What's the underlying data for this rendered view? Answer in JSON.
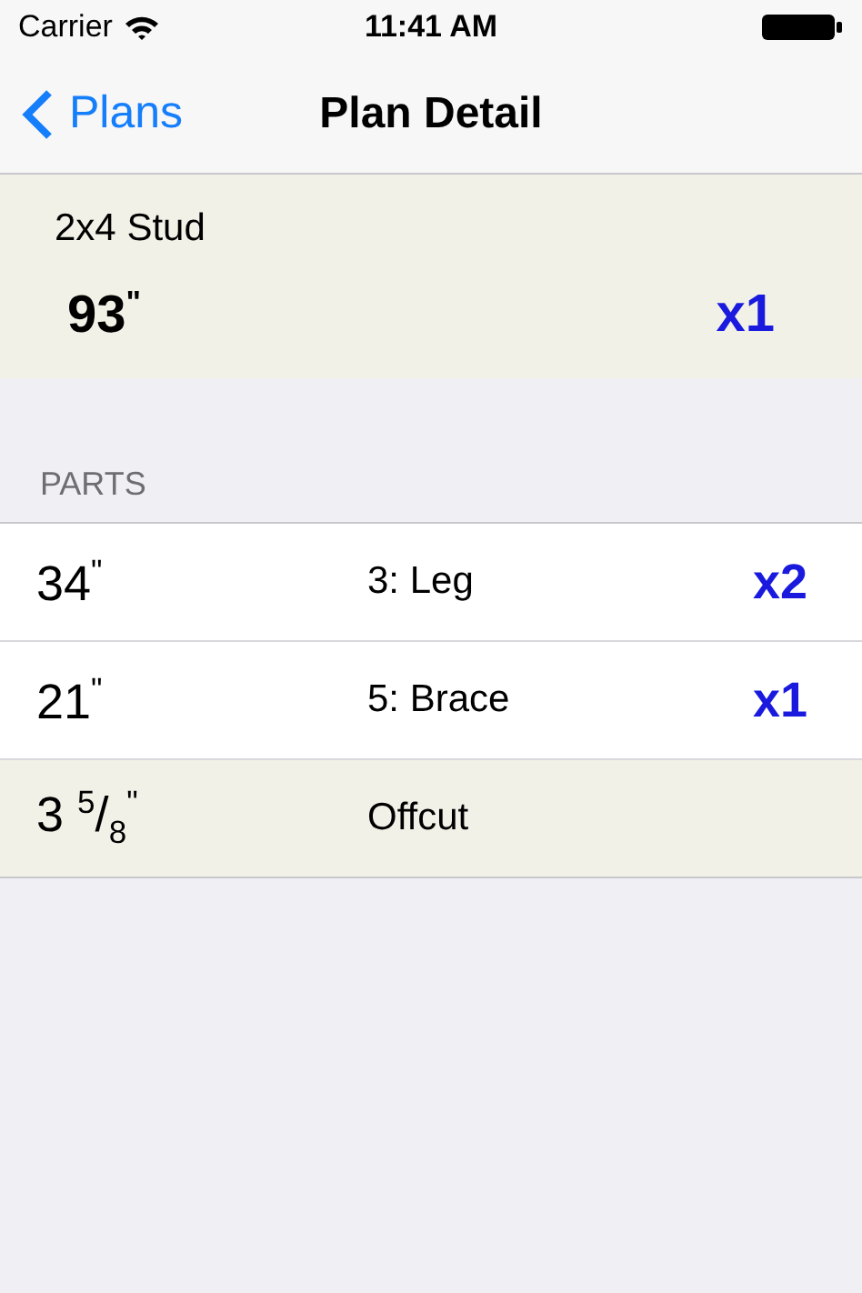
{
  "status_bar": {
    "carrier": "Carrier",
    "time": "11:41 AM"
  },
  "nav_bar": {
    "back": "Plans",
    "title": "Plan Detail"
  },
  "stock": {
    "name": "2x4 Stud",
    "length": "93$^{\"}$",
    "count": "x1"
  },
  "section_header": "PARTS",
  "parts": [
    {
      "kind": "part",
      "length": "34$^{\"}$",
      "label": "3: Leg",
      "count": "x2"
    },
    {
      "kind": "part",
      "length": "21$^{\"}$",
      "label": "5: Brace",
      "count": "x1"
    },
    {
      "kind": "offcut",
      "length": "3 $^{5}$/$_{8}$$^{\"}$",
      "label": "Offcut"
    }
  ]
}
